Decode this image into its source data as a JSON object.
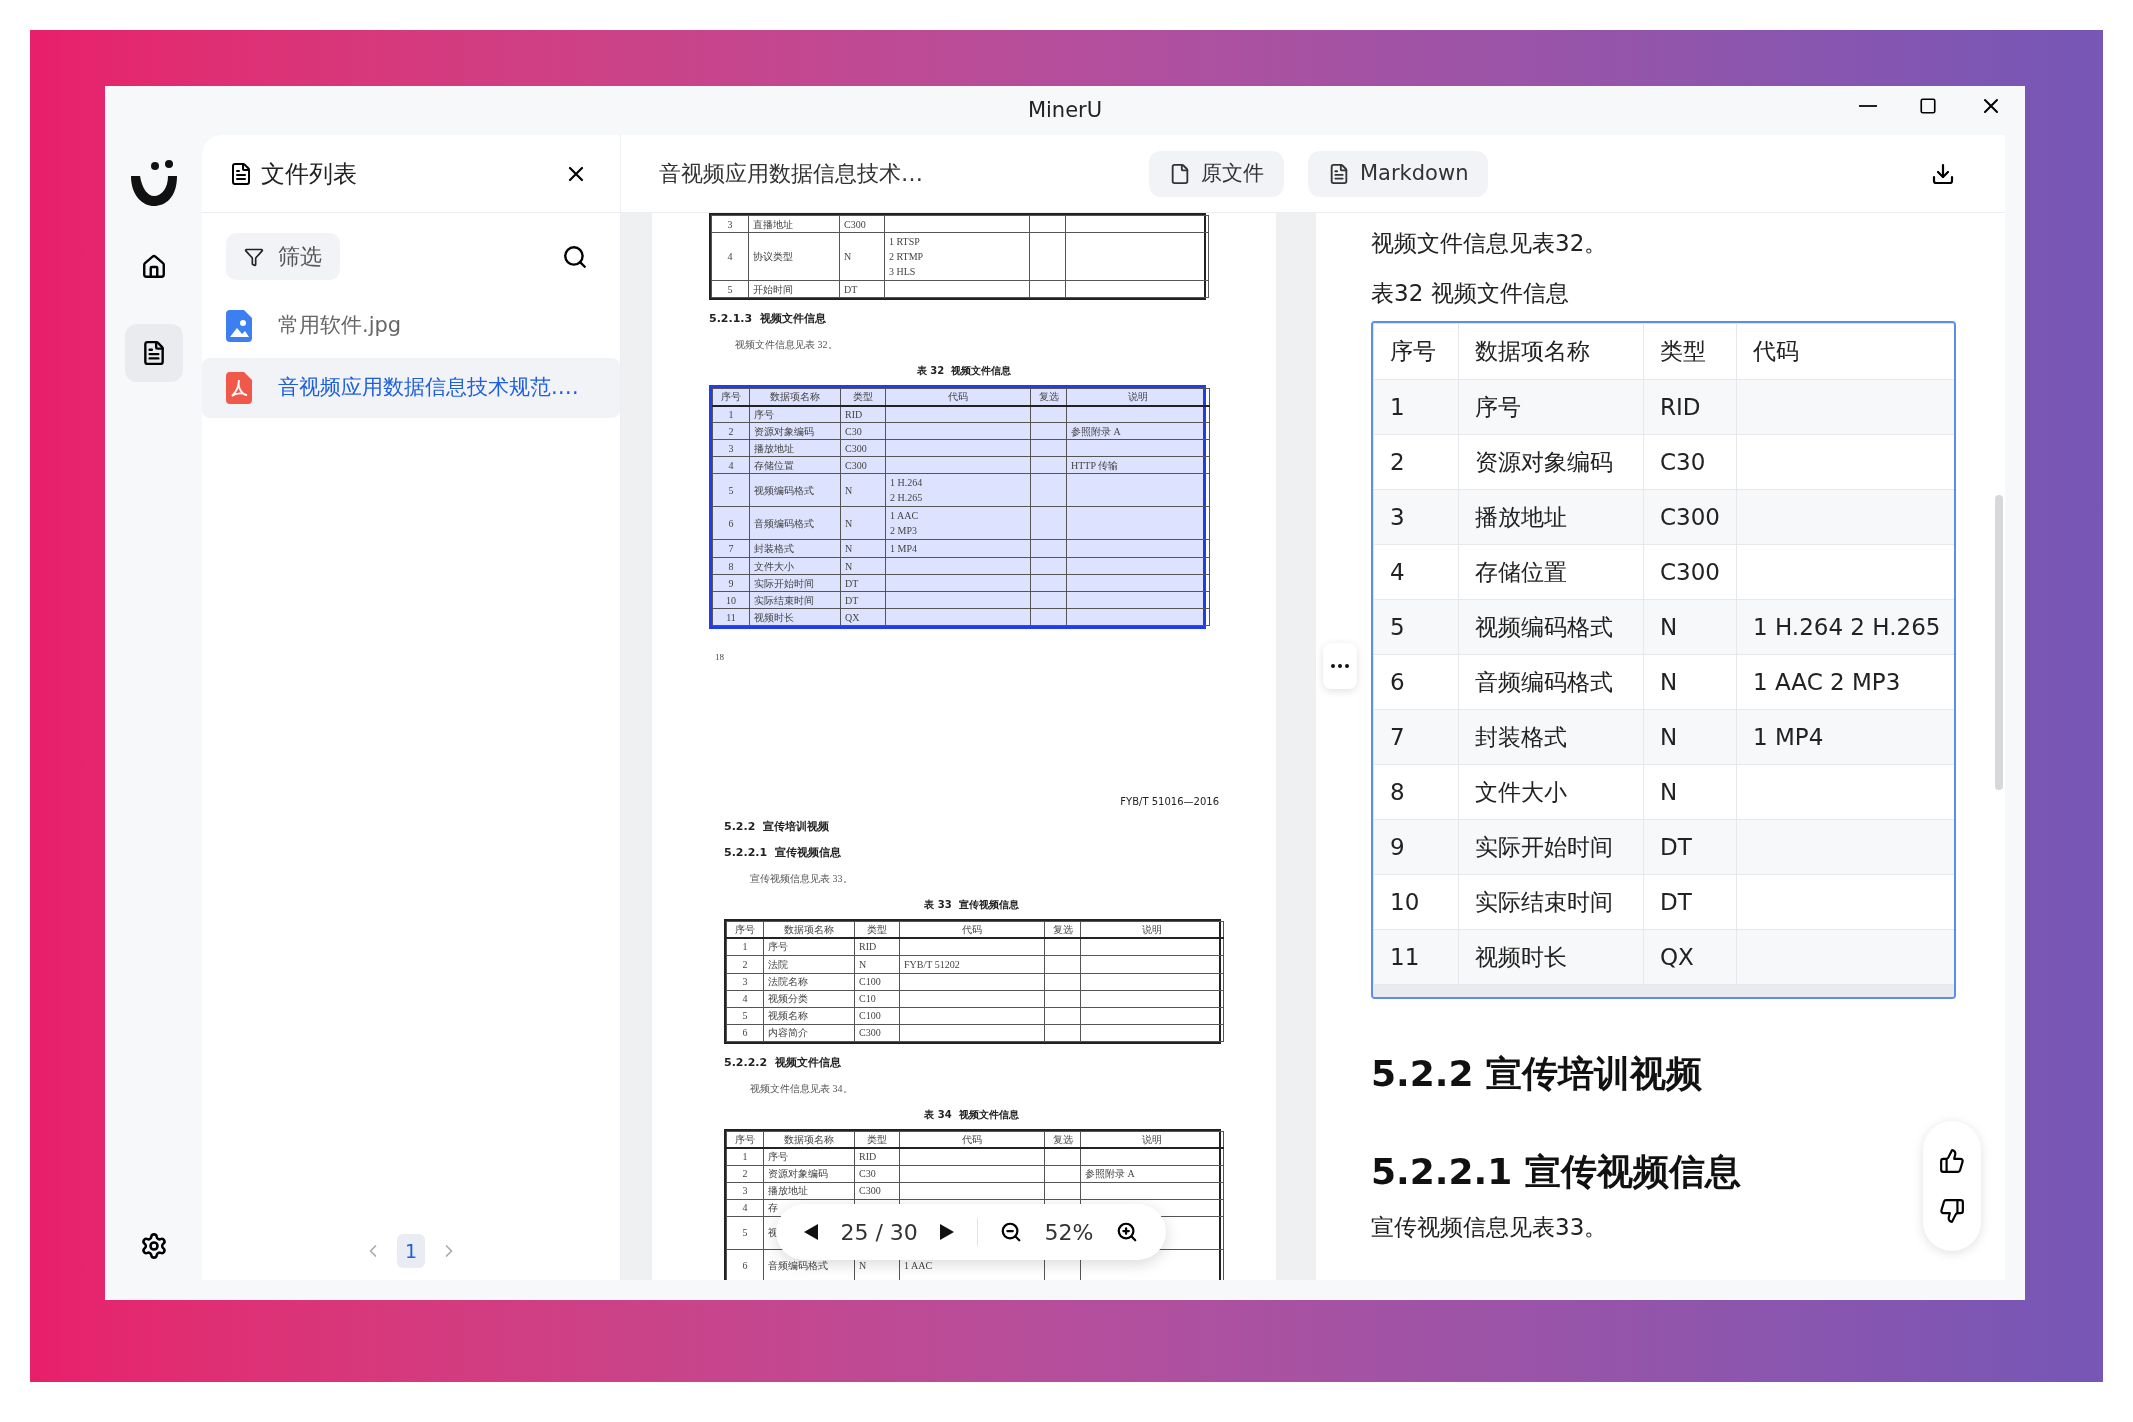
{
  "window": {
    "title": "MinerU"
  },
  "rail": {
    "items": [
      {
        "kind": "home",
        "selected": false
      },
      {
        "kind": "document",
        "selected": true
      }
    ]
  },
  "file_panel": {
    "title": "文件列表",
    "filter_label": "筛选",
    "files": [
      {
        "name": "常用软件.jpg",
        "kind": "image",
        "selected": false
      },
      {
        "name": "音视频应用数据信息技术规范.…",
        "kind": "pdf",
        "selected": true
      }
    ],
    "pages": [
      {
        "label": "1",
        "selected": true
      }
    ]
  },
  "header": {
    "doc_title": "音视频应用数据信息技术…",
    "view_buttons": [
      {
        "label": "原文件",
        "kind": "pdf"
      },
      {
        "label": "Markdown",
        "kind": "markdown"
      }
    ]
  },
  "pdf": {
    "pages": [
      {
        "blocks": [
          {
            "kind": "table",
            "highlighted": false,
            "rows": [
              {
                "no": "3",
                "name": "直播地址",
                "type": "C300"
              },
              {
                "no": "4",
                "name": "协议类型",
                "type": "N",
                "code": [
                  "1 RTSP",
                  "2 RTMP",
                  "3 HLS"
                ]
              },
              {
                "no": "5",
                "name": "开始时间",
                "type": "DT"
              }
            ]
          },
          {
            "kind": "heading",
            "text": "5.2.1.3  视频文件信息"
          },
          {
            "kind": "para",
            "text": "视频文件信息见表 32。"
          },
          {
            "kind": "caption",
            "text": "表 32  视频文件信息"
          },
          {
            "kind": "table",
            "highlighted": true,
            "columns": [
              "序号",
              "数据项名称",
              "类型",
              "代码",
              "复选",
              "说明"
            ],
            "rows": [
              {
                "no": "1",
                "name": "序号",
                "type": "RID"
              },
              {
                "no": "2",
                "name": "资源对象编码",
                "type": "C30",
                "note": "参照附录 A"
              },
              {
                "no": "3",
                "name": "播放地址",
                "type": "C300"
              },
              {
                "no": "4",
                "name": "存储位置",
                "type": "C300",
                "note": "HTTP 传输"
              },
              {
                "no": "5",
                "name": "视频编码格式",
                "type": "N",
                "code": [
                  "1 H.264",
                  "2 H.265"
                ]
              },
              {
                "no": "6",
                "name": "音频编码格式",
                "type": "N",
                "code": [
                  "1 AAC",
                  "2 MP3"
                ]
              },
              {
                "no": "7",
                "name": "封装格式",
                "type": "N",
                "code": [
                  "1 MP4"
                ]
              },
              {
                "no": "8",
                "name": "文件大小",
                "type": "N"
              },
              {
                "no": "9",
                "name": "实际开始时间",
                "type": "DT"
              },
              {
                "no": "10",
                "name": "实际结束时间",
                "type": "DT"
              },
              {
                "no": "11",
                "name": "视频时长",
                "type": "QX"
              }
            ]
          }
        ],
        "page_number": "18"
      },
      {
        "running_header": "FYB/T 51016—2016",
        "blocks": [
          {
            "kind": "heading",
            "text": "5.2.2  宣传培训视频"
          },
          {
            "kind": "heading",
            "text": "5.2.2.1  宣传视频信息"
          },
          {
            "kind": "para",
            "text": "宣传视频信息见表 33。"
          },
          {
            "kind": "caption",
            "text": "表 33  宣传视频信息"
          },
          {
            "kind": "table",
            "highlighted": false,
            "columns": [
              "序号",
              "数据项名称",
              "类型",
              "代码",
              "复选",
              "说明"
            ],
            "rows": [
              {
                "no": "1",
                "name": "序号",
                "type": "RID"
              },
              {
                "no": "2",
                "name": "法院",
                "type": "N",
                "code": [
                  "FYB/T 51202"
                ]
              },
              {
                "no": "3",
                "name": "法院名称",
                "type": "C100"
              },
              {
                "no": "4",
                "name": "视频分类",
                "type": "C10"
              },
              {
                "no": "5",
                "name": "视频名称",
                "type": "C100"
              },
              {
                "no": "6",
                "name": "内容简介",
                "type": "C300"
              }
            ]
          },
          {
            "kind": "heading",
            "text": "5.2.2.2  视频文件信息"
          },
          {
            "kind": "para",
            "text": "视频文件信息见表 34。"
          },
          {
            "kind": "caption",
            "text": "表 34  视频文件信息"
          },
          {
            "kind": "table",
            "highlighted": false,
            "columns": [
              "序号",
              "数据项名称",
              "类型",
              "代码",
              "复选",
              "说明"
            ],
            "rows": [
              {
                "no": "1",
                "name": "序号",
                "type": "RID"
              },
              {
                "no": "2",
                "name": "资源对象编码",
                "type": "C30",
                "note": "参照附录 A"
              },
              {
                "no": "3",
                "name": "播放地址",
                "type": "C300"
              },
              {
                "no": "4",
                "name": "存"
              },
              {
                "no": "5",
                "name": "视",
                "kind": "double"
              },
              {
                "no": "6",
                "name": "音频编码格式",
                "type": "N",
                "code": [
                  "1 AAC"
                ],
                "kind": "double"
              }
            ]
          }
        ]
      }
    ],
    "toolbar": {
      "page_indicator": "25 / 30",
      "zoom": "52%"
    }
  },
  "markdown": {
    "blocks": [
      {
        "kind": "para",
        "text": "视频文件信息见表32。"
      },
      {
        "kind": "para",
        "text": "表32 视频文件信息"
      },
      {
        "kind": "table",
        "selected": true,
        "columns": [
          "序号",
          "数据项名称",
          "类型",
          "代码"
        ],
        "rows": [
          [
            "1",
            "序号",
            "RID"
          ],
          [
            "2",
            "资源对象编码",
            "C30"
          ],
          [
            "3",
            "播放地址",
            "C300"
          ],
          [
            "4",
            "存储位置",
            "C300"
          ],
          [
            "5",
            "视频编码格式",
            "N",
            "1 H.264 2 H.265"
          ],
          [
            "6",
            "音频编码格式",
            "N",
            "1 AAC 2 MP3"
          ],
          [
            "7",
            "封装格式",
            "N",
            "1 MP4"
          ],
          [
            "8",
            "文件大小",
            "N"
          ],
          [
            "9",
            "实际开始时间",
            "DT"
          ],
          [
            "10",
            "实际结束时间",
            "DT"
          ],
          [
            "11",
            "视频时长",
            "QX"
          ]
        ]
      },
      {
        "kind": "heading",
        "text": "5.2.2 宣传培训视频"
      },
      {
        "kind": "heading",
        "text": "5.2.2.1 宣传视频信息"
      },
      {
        "kind": "para",
        "text": "宣传视频信息见表33。"
      }
    ]
  }
}
